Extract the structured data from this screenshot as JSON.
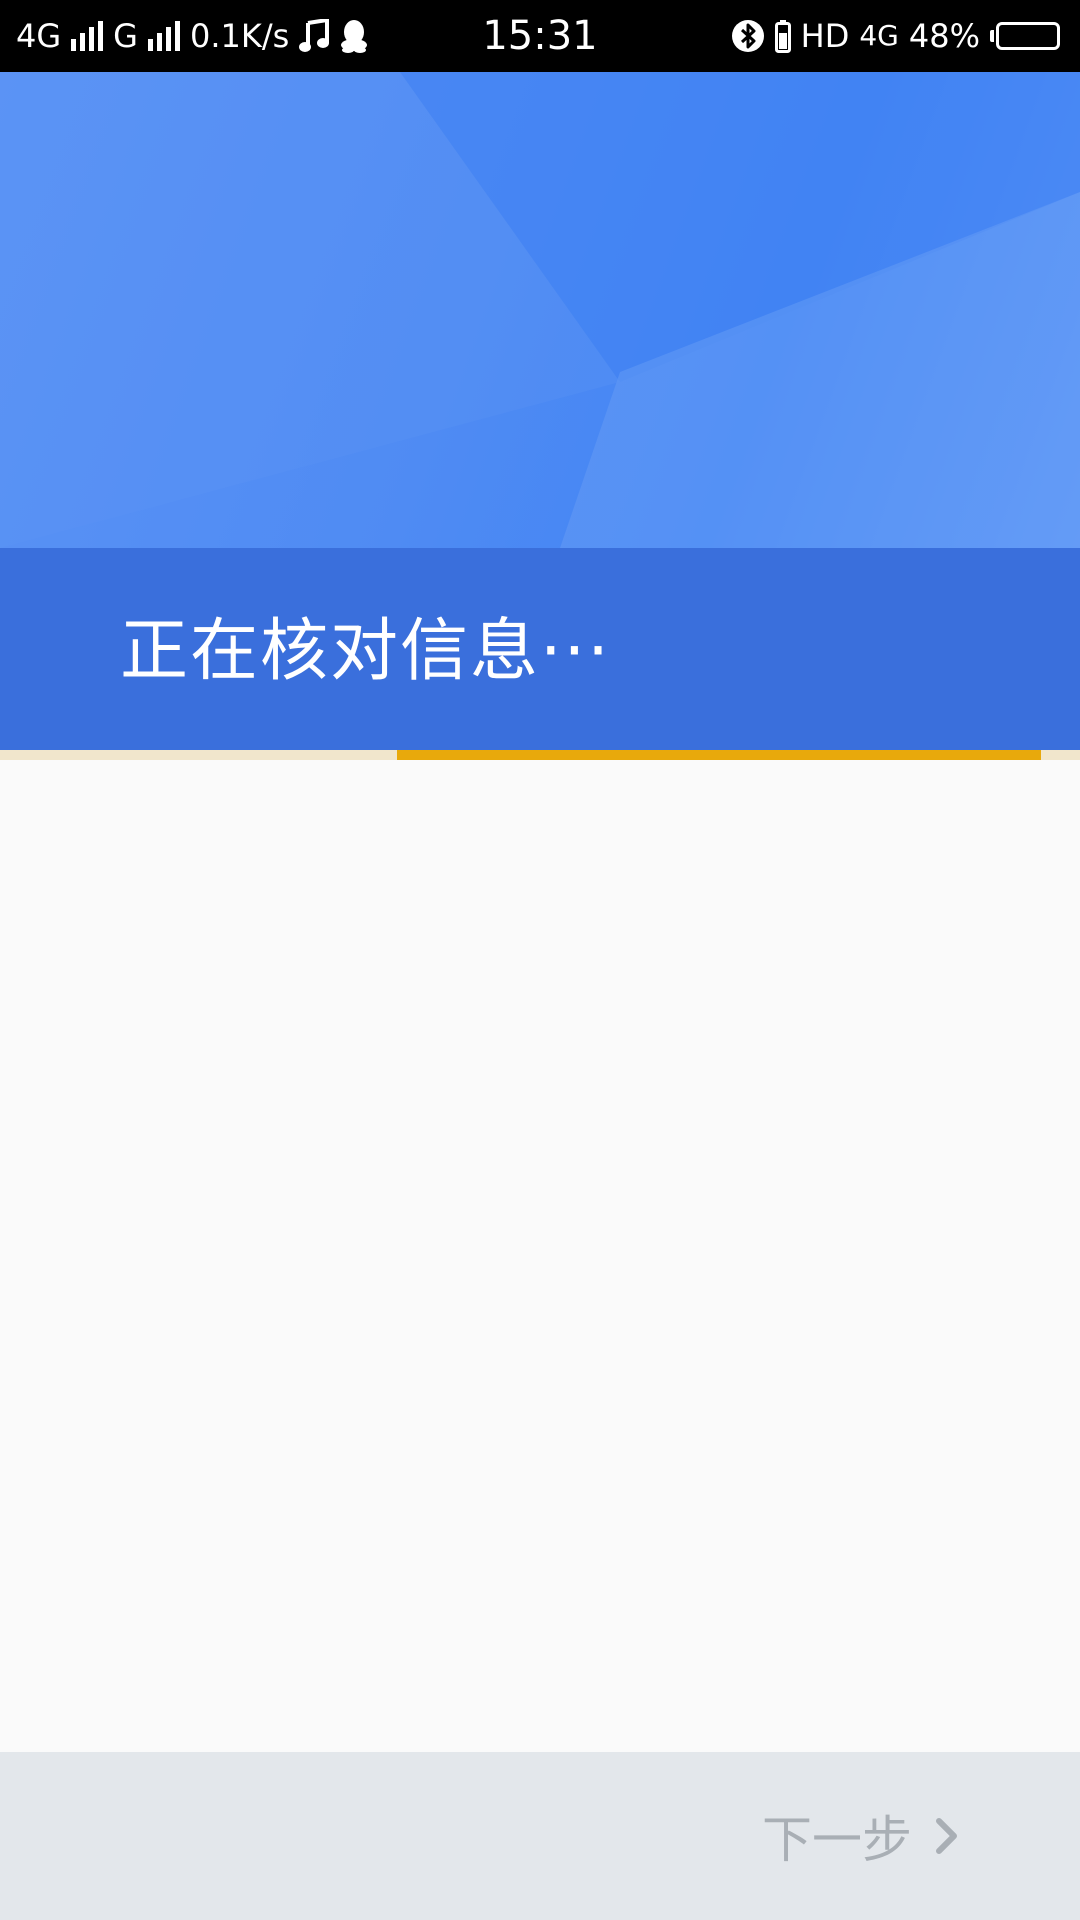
{
  "status_bar": {
    "network1": "4G",
    "network2": "G",
    "speed": "0.1K/s",
    "time": "15:31",
    "hd": "HD",
    "network3": "4G",
    "battery_text": "48%",
    "battery_level": 0.48,
    "icons": [
      "signal-icon",
      "music-icon",
      "qq-icon",
      "bluetooth-icon",
      "battery-icon"
    ]
  },
  "header": {
    "title": "正在核对信息···"
  },
  "progress": {
    "start_fraction": 0.368,
    "end_fraction": 0.964,
    "fill_color": "#e8a90c",
    "track_color": "#f1e6cc"
  },
  "footer": {
    "next_label": "下一步",
    "next_icon": "chevron-right-icon"
  },
  "colors": {
    "hero_blue": "#4385f4",
    "band_blue": "#3a6fdc",
    "footer_bg": "#e3e7eb",
    "disabled_text": "#a9afb5"
  }
}
